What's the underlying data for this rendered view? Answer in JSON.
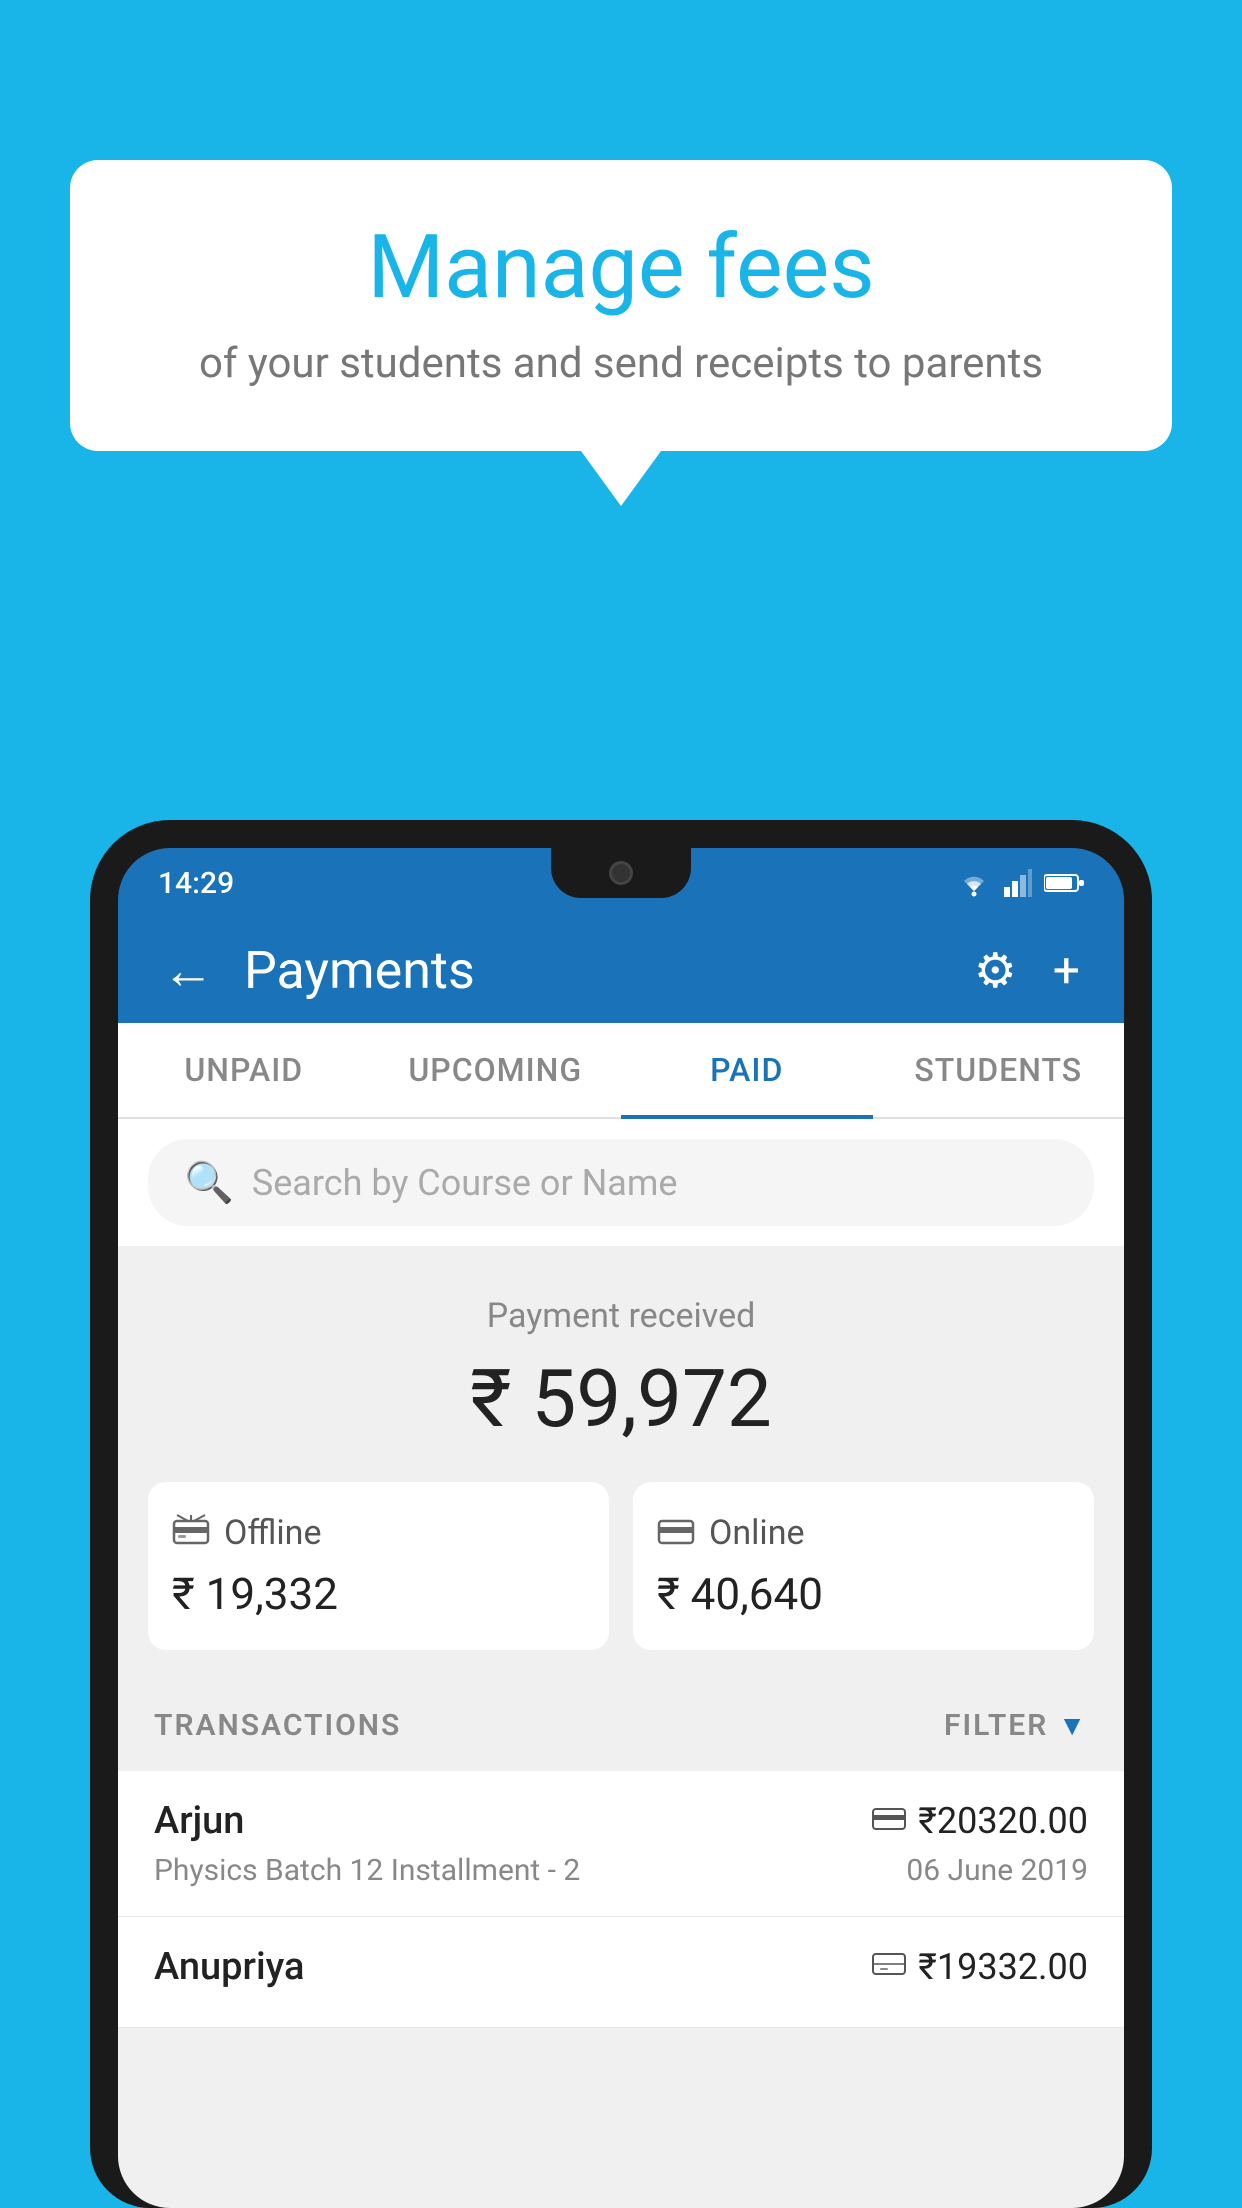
{
  "background_color": "#1ab5e8",
  "speech_bubble": {
    "title": "Manage fees",
    "subtitle": "of your students and send receipts to parents"
  },
  "phone": {
    "status_bar": {
      "time": "14:29"
    },
    "header": {
      "title": "Payments",
      "back_label": "←",
      "settings_icon": "⚙",
      "add_icon": "+"
    },
    "tabs": [
      {
        "label": "UNPAID",
        "active": false
      },
      {
        "label": "UPCOMING",
        "active": false
      },
      {
        "label": "PAID",
        "active": true
      },
      {
        "label": "STUDENTS",
        "active": false
      }
    ],
    "search": {
      "placeholder": "Search by Course or Name"
    },
    "payment_summary": {
      "label": "Payment received",
      "total": "₹ 59,972",
      "offline": {
        "label": "Offline",
        "amount": "₹ 19,332"
      },
      "online": {
        "label": "Online",
        "amount": "₹ 40,640"
      }
    },
    "transactions": {
      "header_label": "TRANSACTIONS",
      "filter_label": "FILTER",
      "items": [
        {
          "name": "Arjun",
          "course": "Physics Batch 12 Installment - 2",
          "amount": "₹20320.00",
          "date": "06 June 2019",
          "payment_type": "online"
        },
        {
          "name": "Anupriya",
          "course": "",
          "amount": "₹19332.00",
          "date": "",
          "payment_type": "offline"
        }
      ]
    }
  }
}
